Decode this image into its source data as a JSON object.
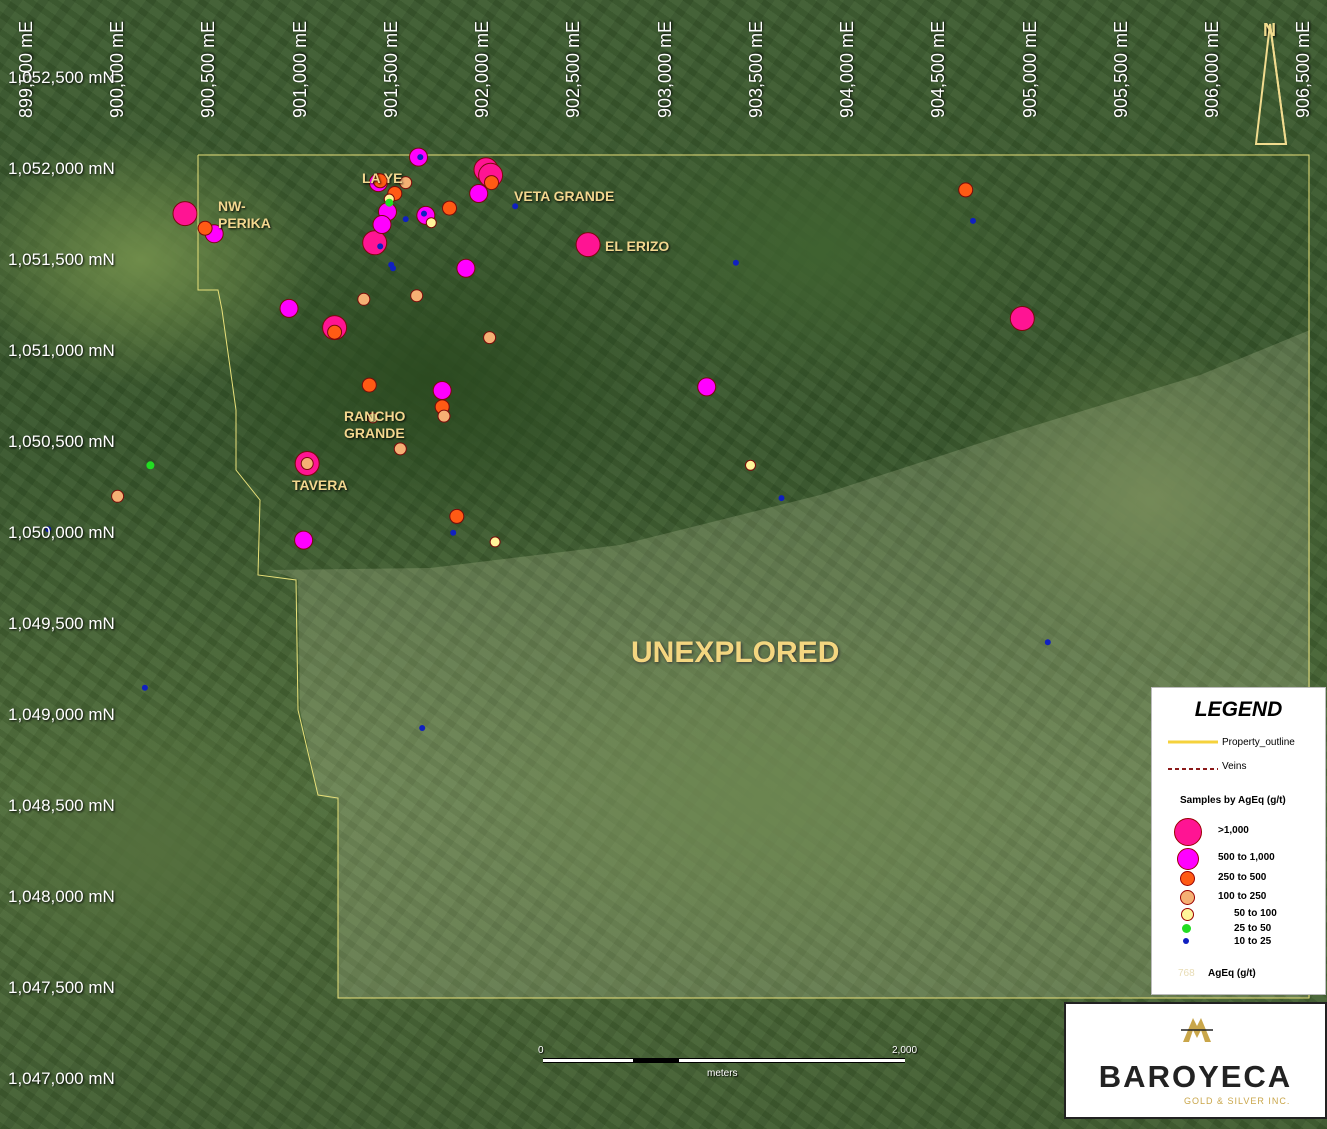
{
  "grid": {
    "eastings": [
      "899,500 mE",
      "900,000 mE",
      "900,500 mE",
      "901,000 mE",
      "901,500 mE",
      "902,000 mE",
      "902,500 mE",
      "903,000 mE",
      "903,500 mE",
      "904,000 mE",
      "904,500 mE",
      "905,000 mE",
      "905,500 mE",
      "906,000 mE",
      "906,500 mE"
    ],
    "northings": [
      "1,052,500 mN",
      "1,052,000 mN",
      "1,051,500 mN",
      "1,051,000 mN",
      "1,050,500 mN",
      "1,050,000 mN",
      "1,049,500 mN",
      "1,049,000 mN",
      "1,048,500 mN",
      "1,048,000 mN",
      "1,047,500 mN",
      "1,047,000 mN"
    ]
  },
  "labels": {
    "nw_perika": "NW-\nPERIKA",
    "la_ye": "LA YE",
    "veta_grande": "VETA GRANDE",
    "el_erizo": "EL ERIZO",
    "rancho_grande": "RANCHO\nGRANDE",
    "tavera": "TAVERA",
    "unexplored": "UNEXPLORED"
  },
  "north_arrow": "N",
  "scale_bar": {
    "start": "0",
    "end": "2,000",
    "unit": "meters"
  },
  "legend": {
    "title": "LEGEND",
    "property_outline": "Property_outline",
    "veins": "Veins",
    "samples_heading": "Samples by AgEq (g/t)",
    "classes": [
      {
        "label": ">1,000",
        "color": "#ff1493"
      },
      {
        "label": "500 to 1,000",
        "color": "#ff00ff"
      },
      {
        "label": "250 to 500",
        "color": "#ff5a14"
      },
      {
        "label": "100 to 250",
        "color": "#f5b074"
      },
      {
        "label": "50 to 100",
        "color": "#fff59a"
      },
      {
        "label": "25 to 50",
        "color": "#22dd22"
      },
      {
        "label": "10 to 25",
        "color": "#1020c0"
      }
    ],
    "label_sample_value": "768",
    "label_sample_caption": "AgEq (g/t)"
  },
  "logo": {
    "name": "BAROYECA",
    "tagline": "GOLD & SILVER INC."
  },
  "colors": {
    "outline": "#e8e07a",
    "label": "#f3d78f",
    "vein": "#8b1a1a"
  },
  "samples": [
    {
      "cls": 0,
      "e": 900350,
      "n": 1051750
    },
    {
      "cls": 0,
      "e": 901170,
      "n": 1051125
    },
    {
      "cls": 0,
      "e": 901390,
      "n": 1051590
    },
    {
      "cls": 0,
      "e": 902000,
      "n": 1051990
    },
    {
      "cls": 0,
      "e": 902025,
      "n": 1051960
    },
    {
      "cls": 0,
      "e": 902560,
      "n": 1051580
    },
    {
      "cls": 0,
      "e": 904940,
      "n": 1051175
    },
    {
      "cls": 0,
      "e": 901020,
      "n": 1050380
    },
    {
      "cls": 1,
      "e": 900510,
      "n": 1051640
    },
    {
      "cls": 1,
      "e": 900920,
      "n": 1051230
    },
    {
      "cls": 1,
      "e": 901000,
      "n": 1049960
    },
    {
      "cls": 1,
      "e": 901410,
      "n": 1051920
    },
    {
      "cls": 1,
      "e": 901460,
      "n": 1051760
    },
    {
      "cls": 1,
      "e": 901430,
      "n": 1051690
    },
    {
      "cls": 1,
      "e": 901630,
      "n": 1052060
    },
    {
      "cls": 1,
      "e": 901670,
      "n": 1051740
    },
    {
      "cls": 1,
      "e": 901890,
      "n": 1051450
    },
    {
      "cls": 1,
      "e": 901960,
      "n": 1051860
    },
    {
      "cls": 1,
      "e": 901760,
      "n": 1050780
    },
    {
      "cls": 1,
      "e": 903210,
      "n": 1050800
    },
    {
      "cls": 2,
      "e": 900460,
      "n": 1051670
    },
    {
      "cls": 2,
      "e": 901420,
      "n": 1051930
    },
    {
      "cls": 2,
      "e": 901500,
      "n": 1051860
    },
    {
      "cls": 2,
      "e": 901800,
      "n": 1051780
    },
    {
      "cls": 2,
      "e": 902030,
      "n": 1051920
    },
    {
      "cls": 2,
      "e": 901170,
      "n": 1051100
    },
    {
      "cls": 2,
      "e": 901360,
      "n": 1050810
    },
    {
      "cls": 2,
      "e": 901760,
      "n": 1050690
    },
    {
      "cls": 2,
      "e": 901840,
      "n": 1050090
    },
    {
      "cls": 2,
      "e": 904630,
      "n": 1051880
    },
    {
      "cls": 3,
      "e": 901560,
      "n": 1051920
    },
    {
      "cls": 3,
      "e": 901330,
      "n": 1051280
    },
    {
      "cls": 3,
      "e": 901620,
      "n": 1051300
    },
    {
      "cls": 3,
      "e": 902020,
      "n": 1051070
    },
    {
      "cls": 3,
      "e": 901770,
      "n": 1050640
    },
    {
      "cls": 3,
      "e": 901530,
      "n": 1050460
    },
    {
      "cls": 3,
      "e": 901020,
      "n": 1050380
    },
    {
      "cls": 3,
      "e": 899980,
      "n": 1050200
    },
    {
      "cls": 4,
      "e": 901470,
      "n": 1051830
    },
    {
      "cls": 4,
      "e": 901700,
      "n": 1051700
    },
    {
      "cls": 4,
      "e": 901380,
      "n": 1050630
    },
    {
      "cls": 4,
      "e": 902050,
      "n": 1049950
    },
    {
      "cls": 4,
      "e": 903450,
      "n": 1050370
    },
    {
      "cls": 5,
      "e": 900160,
      "n": 1050370
    },
    {
      "cls": 5,
      "e": 901470,
      "n": 1051810
    },
    {
      "cls": 6,
      "e": 901640,
      "n": 1052060
    },
    {
      "cls": 6,
      "e": 901660,
      "n": 1051750
    },
    {
      "cls": 6,
      "e": 901480,
      "n": 1051470
    },
    {
      "cls": 6,
      "e": 901490,
      "n": 1051450
    },
    {
      "cls": 6,
      "e": 901420,
      "n": 1051570
    },
    {
      "cls": 6,
      "e": 901560,
      "n": 1051720
    },
    {
      "cls": 6,
      "e": 902160,
      "n": 1051790
    },
    {
      "cls": 6,
      "e": 903370,
      "n": 1051480
    },
    {
      "cls": 6,
      "e": 904670,
      "n": 1051710
    },
    {
      "cls": 6,
      "e": 903620,
      "n": 1050190
    },
    {
      "cls": 6,
      "e": 901820,
      "n": 1050000
    },
    {
      "cls": 6,
      "e": 899600,
      "n": 1050020
    },
    {
      "cls": 6,
      "e": 905080,
      "n": 1049400
    },
    {
      "cls": 6,
      "e": 900130,
      "n": 1049150
    },
    {
      "cls": 6,
      "e": 901650,
      "n": 1048930
    }
  ]
}
